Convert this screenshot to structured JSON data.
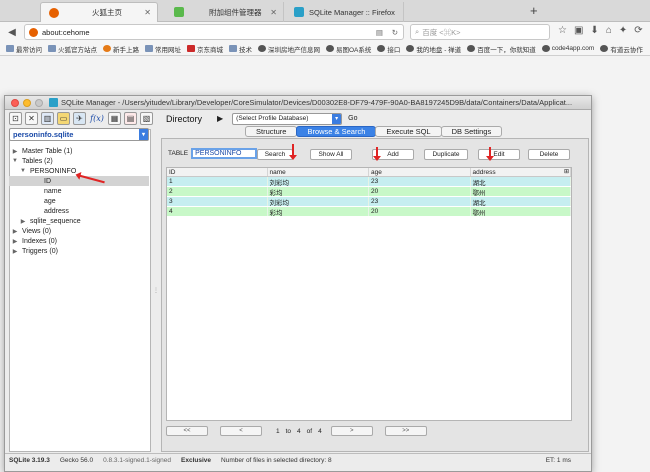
{
  "browser": {
    "tabs": [
      {
        "title": "火狐主页",
        "icon_color": "#e66000"
      },
      {
        "title": "附加组件管理器",
        "icon_color": "#5ab94c"
      },
      {
        "title": "SQLite Manager :: Firefox 附加",
        "icon_color": "#2aa0c8"
      }
    ],
    "url": "about:cehome",
    "search_placeholder": "百度 <⌘K>",
    "bookmarks": [
      "最常访问",
      "火狐官方站点",
      "新手上路",
      "常用网址",
      "京东商城",
      "技术",
      "深圳房地产信息网",
      "易图OA系统",
      "接口",
      "我的地盘 - 禅道",
      "百度一下，你就知道",
      "code4app.com",
      "有道云协作"
    ]
  },
  "window": {
    "title": "SQLite Manager - /Users/yitudev/Library/Developer/CoreSimulator/Devices/D00302E8-DF79-479F-90A0-BA8197245D9B/data/Containers/Data/Applicat...",
    "directory_label": "Directory",
    "profile_select": "(Select Profile Database)",
    "go_label": "Go",
    "fx_label": "f(x)"
  },
  "sidebar": {
    "db_name": "personinfo.sqlite",
    "tree": [
      {
        "label": "Master Table (1)",
        "twisty": "▶",
        "indent": 0
      },
      {
        "label": "Tables (2)",
        "twisty": "▼",
        "indent": 0
      },
      {
        "label": "PERSONINFO",
        "twisty": "▼",
        "indent": 1
      },
      {
        "label": "ID",
        "twisty": "",
        "indent": 2,
        "selected": true
      },
      {
        "label": "name",
        "twisty": "",
        "indent": 2
      },
      {
        "label": "age",
        "twisty": "",
        "indent": 2
      },
      {
        "label": "address",
        "twisty": "",
        "indent": 2
      },
      {
        "label": "sqlite_sequence",
        "twisty": "▶",
        "indent": 1
      },
      {
        "label": "Views (0)",
        "twisty": "▶",
        "indent": 0
      },
      {
        "label": "Indexes (0)",
        "twisty": "▶",
        "indent": 0
      },
      {
        "label": "Triggers (0)",
        "twisty": "▶",
        "indent": 0
      }
    ]
  },
  "panel": {
    "tabs": [
      "Structure",
      "Browse & Search",
      "Execute SQL",
      "DB Settings"
    ],
    "table_label": "TABLE",
    "table_value": "PERSONINFO",
    "buttons": {
      "search": "Search",
      "show_all": "Show All",
      "add": "Add",
      "duplicate": "Duplicate",
      "edit": "Edit",
      "delete": "Delete"
    },
    "columns": [
      "ID",
      "name",
      "age",
      "address"
    ],
    "rows": [
      [
        "1",
        "刘彩均",
        "23",
        "湖北"
      ],
      [
        "2",
        "彩均",
        "20",
        "鄂州"
      ],
      [
        "3",
        "刘彩均",
        "23",
        "湖北"
      ],
      [
        "4",
        "彩均",
        "20",
        "鄂州"
      ]
    ],
    "pager": {
      "first": "<<",
      "prev": "<",
      "from": "1",
      "to_label": "to",
      "to": "4",
      "of_label": "of",
      "total": "4",
      "next": ">",
      "last": ">>"
    }
  },
  "status": {
    "version": "SQLite 3.19.3",
    "gecko": "Gecko 56.0",
    "ext": "0.8.3.1-signed.1-signed",
    "mode": "Exclusive",
    "files": "Number of files in selected directory: 8",
    "et": "ET: 1 ms"
  },
  "colors": {
    "accent": "#3b82e6",
    "row_green": "#c8f8c8",
    "row_teal": "#c6eef0",
    "annotation_red": "#e02424"
  }
}
